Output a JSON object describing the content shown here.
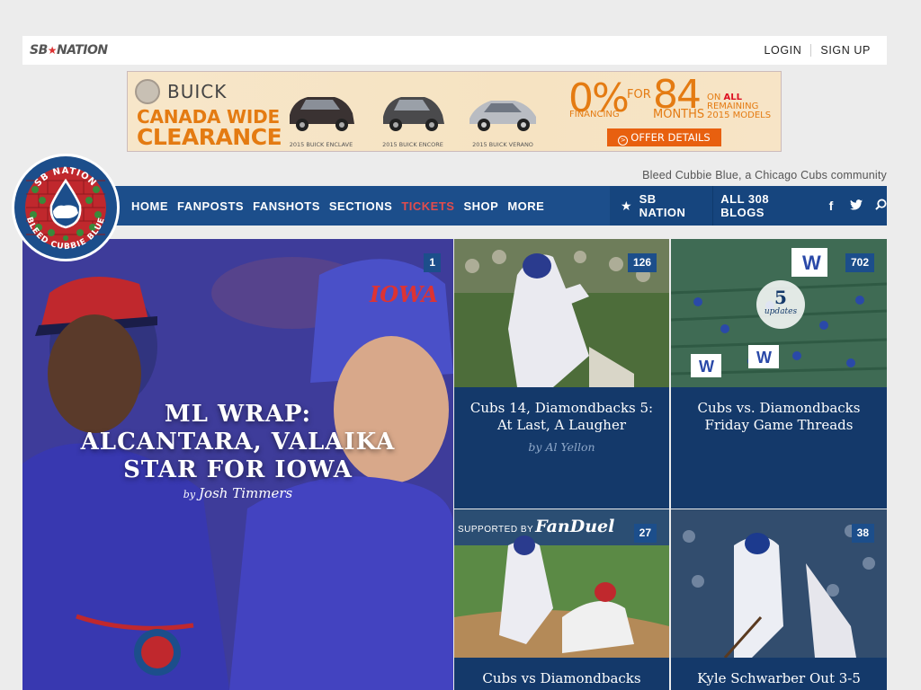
{
  "header": {
    "logo_text": "SBNATION",
    "login": "LOGIN",
    "signup": "SIGN UP"
  },
  "ad": {
    "brand": "BUICK",
    "headline1": "CANADA WIDE",
    "headline2": "CLEARANCE",
    "cars": [
      "2015 BUICK ENCLAVE",
      "2015 BUICK ENCORE",
      "2015 BUICK VERANO"
    ],
    "rate": "0%",
    "financing": "FINANCING",
    "for": "FOR",
    "months_num": "84",
    "months": "MONTHS",
    "on": "ON",
    "all": "ALL",
    "remaining": "REMAINING",
    "models": "2015 MODELS",
    "cta": "OFFER DETAILS"
  },
  "tagline": "Bleed Cubbie Blue, a Chicago Cubs community",
  "nav": {
    "items": [
      "HOME",
      "FANPOSTS",
      "FANSHOTS",
      "SECTIONS",
      "TICKETS",
      "SHOP",
      "MORE"
    ],
    "sbnation": "SB NATION",
    "all_blogs": "ALL 308 BLOGS",
    "social": [
      "f",
      "t"
    ]
  },
  "badge": {
    "top_text": "SB NATION",
    "bottom_text": "BLEED CUBBIE BLUE"
  },
  "hero": {
    "title_lines": [
      "ML WRAP:",
      "ALCANTARA, VALAIKA",
      "STAR FOR IOWA"
    ],
    "by": "by",
    "author": "Josh Timmers",
    "count": "1"
  },
  "tiles": [
    {
      "title_lines": [
        "Cubs 14, Diamondbacks 5:",
        "At Last, A Laugher"
      ],
      "by": "by",
      "author": "Al Yellon",
      "count": "126"
    },
    {
      "title_lines": [
        "Cubs vs. Diamondbacks",
        "Friday Game Threads"
      ],
      "count": "702",
      "updates_num": "5",
      "updates_label": "updates"
    },
    {
      "title_lines": [
        "Cubs vs Diamondbacks"
      ],
      "count": "27",
      "supported_by": "SUPPORTED BY",
      "sponsor": "FanDuel"
    },
    {
      "title_lines": [
        "Kyle Schwarber Out 3-5"
      ],
      "count": "38"
    }
  ],
  "colors": {
    "nav_blue": "#1c4e8b",
    "tile_navy": "#14396a",
    "tickets_red": "#e34c4c",
    "ad_orange": "#e47b12"
  }
}
